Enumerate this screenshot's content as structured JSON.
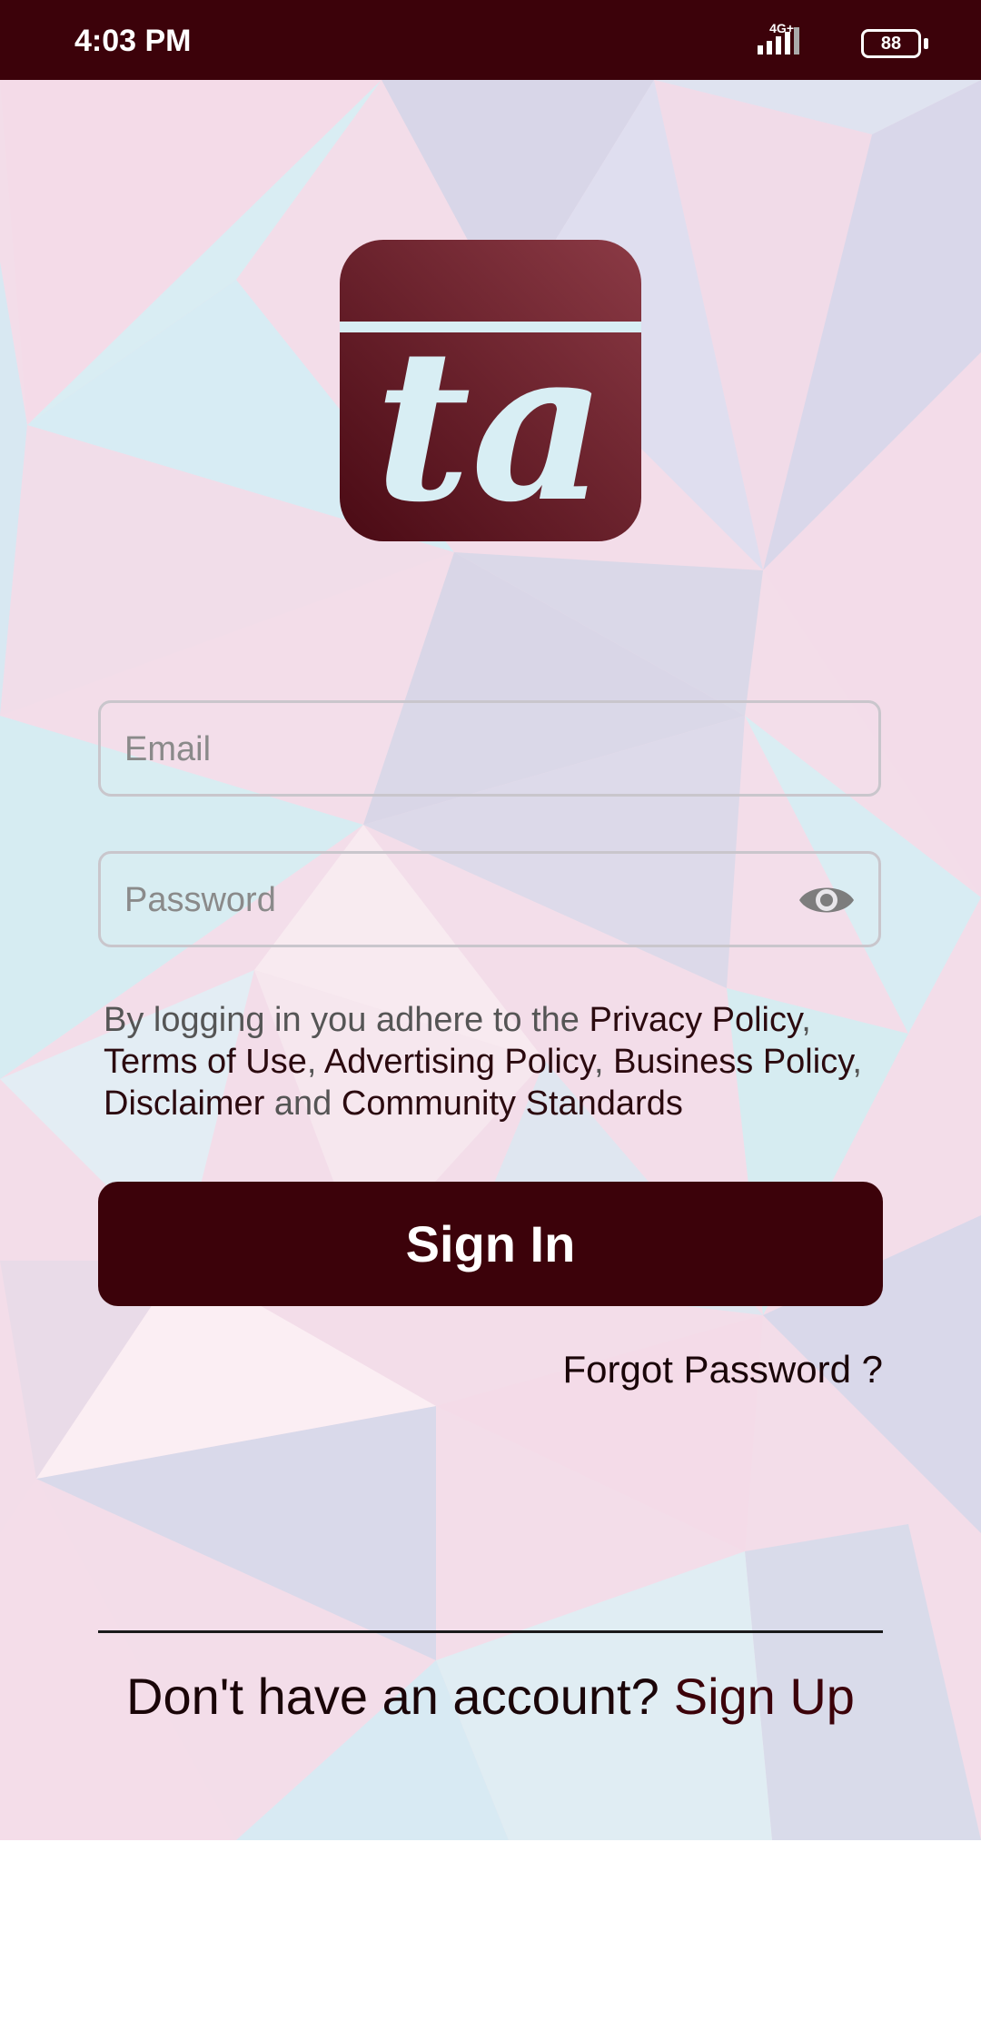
{
  "status_bar": {
    "time": "4:03 PM",
    "network": "4G+",
    "battery": "88"
  },
  "logo": {
    "text": "ta",
    "icon": "app-logo"
  },
  "login_form": {
    "email_placeholder": "Email",
    "email_value": "",
    "password_placeholder": "Password",
    "password_value": "",
    "eye_icon": "eye-icon"
  },
  "policy": {
    "prefix": "By logging in you adhere to the ",
    "privacy_policy": "Privacy Policy",
    "comma1": ", ",
    "terms_of_use": "Terms of Use",
    "comma2": ", ",
    "advertising_policy": "Advertising Policy",
    "comma3": ", ",
    "business_policy": "Business Policy",
    "comma4": ", ",
    "disclaimer": "Disclaimer",
    "and": " and ",
    "community_standards": "Community Standards"
  },
  "buttons": {
    "sign_in": "Sign In",
    "forgot_password": "Forgot Password ?"
  },
  "footer": {
    "question": "Don't have an account?",
    "sign_up": "Sign Up"
  },
  "colors": {
    "brand": "#3c020a",
    "logo_gradient_start": "#8b3a45",
    "logo_gradient_end": "#4a0a14",
    "background_pink": "#f6dde9",
    "background_blue": "#d8eef4",
    "background_lavender": "#dcd9e8"
  }
}
